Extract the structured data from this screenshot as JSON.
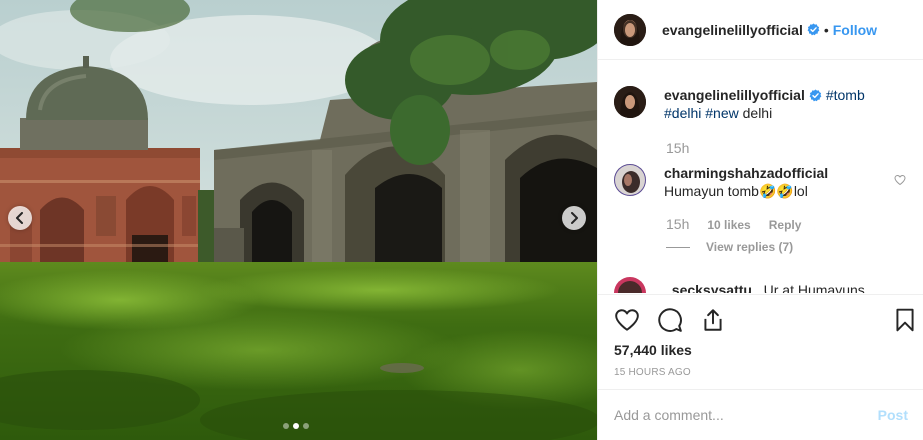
{
  "post": {
    "author": "evangelinelillyofficial",
    "follow_label": "Follow",
    "separator": "•",
    "carousel": {
      "total": 3,
      "active": 2
    }
  },
  "caption": {
    "username": "evangelinelillyofficial",
    "tags": [
      "#tomb",
      "#delhi",
      "#new"
    ],
    "text": "delhi",
    "time": "15h"
  },
  "comments": [
    {
      "username": "charmingshahzadofficial",
      "text_pre": "Humayun tomb",
      "emoji": "🤣",
      "text_post": "lol",
      "time": "15h",
      "likes": "10 likes",
      "reply_label": "Reply",
      "view_replies": "View replies (7)"
    },
    {
      "username": "_secksysattu_",
      "text": "Ur at Humayuns"
    }
  ],
  "stats": {
    "likes": "57,440 likes",
    "ago": "15 HOURS AGO"
  },
  "composer": {
    "placeholder": "Add a comment...",
    "post_label": "Post"
  },
  "colors": {
    "link": "#3897f0",
    "hashtag": "#003569",
    "verified": "#3897f0",
    "muted": "#999999"
  }
}
